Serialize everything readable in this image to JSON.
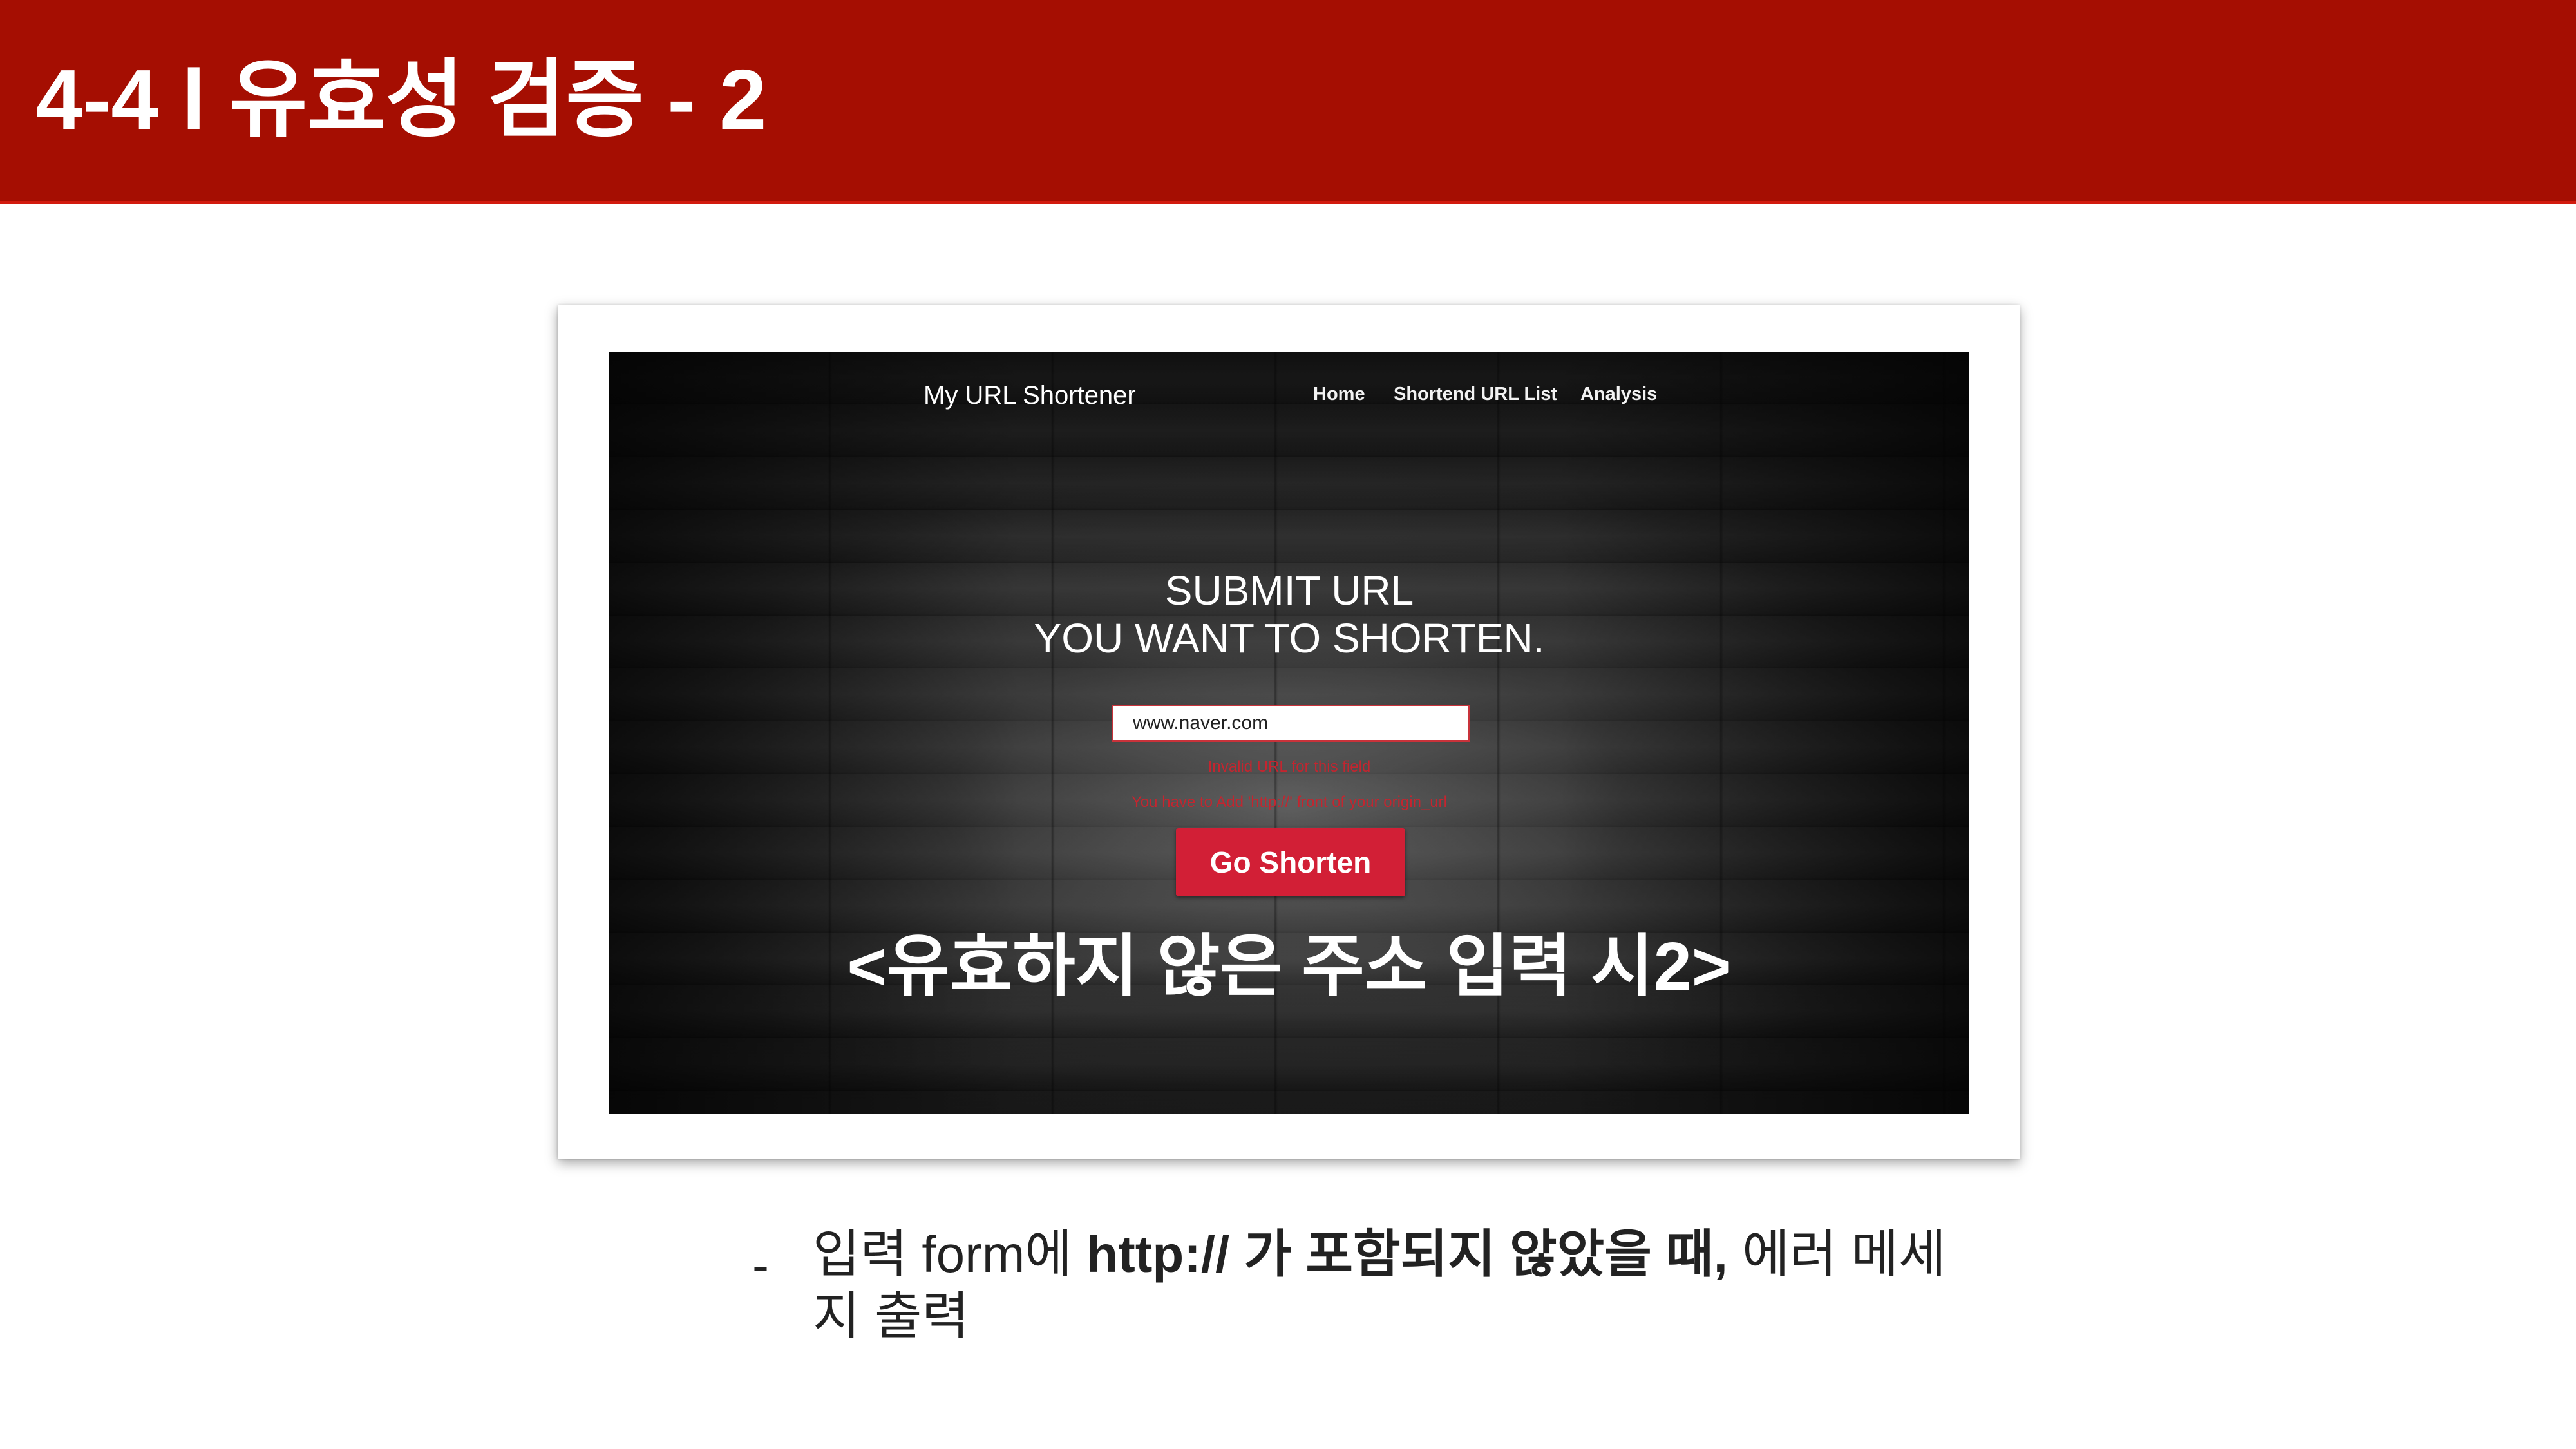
{
  "slide": {
    "title": "4-4 l 유효성 검증 - 2"
  },
  "screenshot": {
    "brand": "My URL Shortener",
    "nav": {
      "home": "Home",
      "list": "Shortend URL List",
      "analysis": "Analysis"
    },
    "headline_line1": "SUBMIT URL",
    "headline_line2": "YOU WANT TO SHORTEN.",
    "input_value": "www.naver.com",
    "error_line1": "Invalid URL for this field",
    "error_line2": "You have to Add 'http://' front of your origin_url",
    "button_label": "Go Shorten",
    "caption": "<유효하지 않은 주소 입력 시2>"
  },
  "description": {
    "bullet": "-",
    "part1": "입력 form에 ",
    "part2_bold": "http:// 가 포함되지 않았을 때,",
    "part3": " 에러 메세지 출력"
  },
  "colors": {
    "title_bar": "#a50e02",
    "button": "#d21f36",
    "error_text": "#c4252f"
  }
}
